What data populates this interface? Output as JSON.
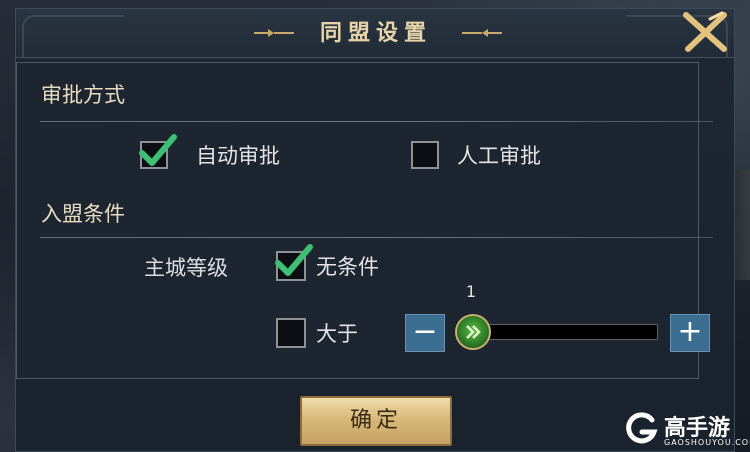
{
  "dialog": {
    "title": "同盟设置"
  },
  "approval": {
    "header": "审批方式",
    "options": [
      {
        "label": "自动审批",
        "checked": true
      },
      {
        "label": "人工审批",
        "checked": false
      }
    ]
  },
  "join": {
    "header": "入盟条件",
    "city_level_label": "主城等级",
    "options": [
      {
        "label": "无条件",
        "checked": true
      },
      {
        "label": "大于",
        "checked": false
      }
    ],
    "level_value": "1",
    "decrement_symbol": "−",
    "increment_symbol": "+"
  },
  "confirm_label": "确定",
  "watermark": {
    "name": "高手游",
    "url": "GAOSHOUYOU.COM"
  },
  "colors": {
    "accent_gold": "#e6d3a8",
    "check_green": "#3fbf74",
    "button_blue": "#3c6e92"
  }
}
